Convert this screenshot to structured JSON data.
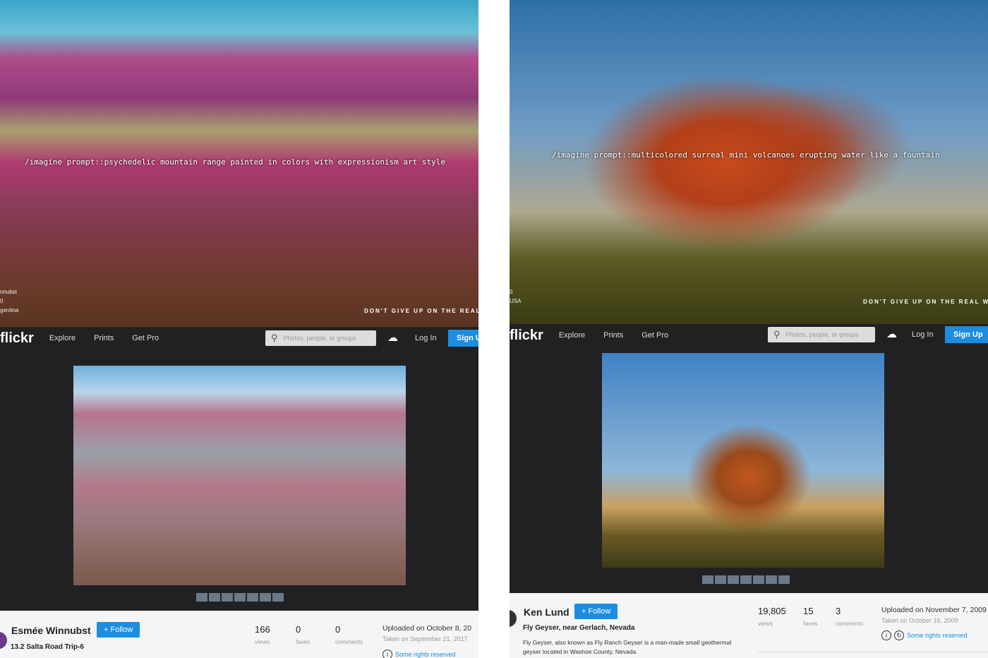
{
  "left": {
    "hero": {
      "prompt": "/imagine prompt::psychedelic mountain range painted in colors with expressionism art style",
      "credit_lines": [
        "nnubst",
        "0",
        "gentina"
      ],
      "tagline": "DON'T GIVE UP ON THE REAL WO"
    },
    "nav": {
      "logo": "flickr",
      "links": [
        "Explore",
        "Prints",
        "Get Pro"
      ],
      "search_placeholder": "Photos, people, or groups",
      "login": "Log In",
      "signup": "Sign U"
    },
    "info": {
      "author": "Esmée Winnubst",
      "follow": "+ Follow",
      "title": "13.2 Salta Road Trip-6",
      "stats": [
        {
          "value": "166",
          "label": "views"
        },
        {
          "value": "0",
          "label": "faves"
        },
        {
          "value": "0",
          "label": "comments"
        }
      ],
      "uploaded": "Uploaded on October 8, 20",
      "taken": "Taken on September 21, 2017",
      "rights": "Some rights reserved"
    }
  },
  "right": {
    "hero": {
      "prompt": "/imagine prompt::multicolored surreal mini volcanoes erupting water like a fountain",
      "credit_lines": [
        "0",
        "USA"
      ],
      "tagline": "DON'T GIVE UP ON THE REAL WORLD"
    },
    "nav": {
      "logo": "flickr",
      "links": [
        "Explore",
        "Prints",
        "Get Pro"
      ],
      "search_placeholder": "Photos, people, or groups",
      "login": "Log In",
      "signup": "Sign Up"
    },
    "info": {
      "author": "Ken Lund",
      "follow": "+ Follow",
      "title": "Fly Geyser, near Gerlach, Nevada",
      "description": "Fly Geyser, also known as Fly Ranch Geyser is a man-made small geothermal geyser located in Washoe County, Nevada",
      "stats": [
        {
          "value": "19,805",
          "label": "views"
        },
        {
          "value": "15",
          "label": "faves"
        },
        {
          "value": "3",
          "label": "comments"
        }
      ],
      "uploaded": "Uploaded on November 7, 2009",
      "taken": "Taken on October 16, 2009",
      "rights": "Some rights reserved"
    }
  },
  "colors": {
    "accent": "#1c8de0",
    "nav_bg": "#212124",
    "info_bg": "#f3f5f6"
  }
}
